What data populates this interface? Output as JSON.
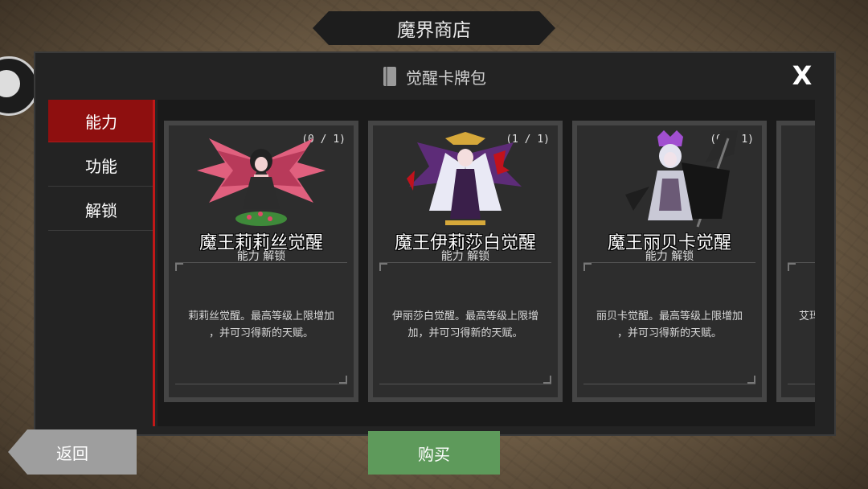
{
  "shop": {
    "title": "魔界商店"
  },
  "panel": {
    "title": "觉醒卡牌包",
    "close_label": "X"
  },
  "tabs": [
    {
      "label": "能力",
      "active": true
    },
    {
      "label": "功能",
      "active": false
    },
    {
      "label": "解锁",
      "active": false
    }
  ],
  "cards": [
    {
      "count": "(0 / 1)",
      "name": "魔王莉莉丝觉醒",
      "subtitle": "能力 解锁",
      "desc_line1": "莉莉丝觉醒。最高等级上限增加",
      "desc_line2": "，并可习得新的天赋。",
      "palette": "pink-wings"
    },
    {
      "count": "(1 / 1)",
      "name": "魔王伊莉莎白觉醒",
      "subtitle": "能力 解锁",
      "desc_line1": "伊丽莎白觉醒。最高等级上限增",
      "desc_line2": "加，并可习得新的天赋。",
      "palette": "purple-gold"
    },
    {
      "count": "(0 / 1)",
      "name": "魔王丽贝卡觉醒",
      "subtitle": "能力 解锁",
      "desc_line1": "丽贝卡觉醒。最高等级上限增加",
      "desc_line2": "，并可习得新的天赋。",
      "palette": "dark-reaper"
    },
    {
      "count": "",
      "name": "",
      "subtitle": "",
      "desc_line1": "艾玛",
      "desc_line2": "",
      "palette": "partial"
    }
  ],
  "nav": {
    "next_icon": "chevron-right-icon",
    "next_glyph": "›"
  },
  "footer": {
    "back_label": "返回",
    "buy_label": "购买"
  },
  "colors": {
    "accent_red": "#c01818",
    "active_tab": "#8e0f0f",
    "buy_green": "#5e9a5b",
    "back_gray": "#9e9e9e"
  }
}
